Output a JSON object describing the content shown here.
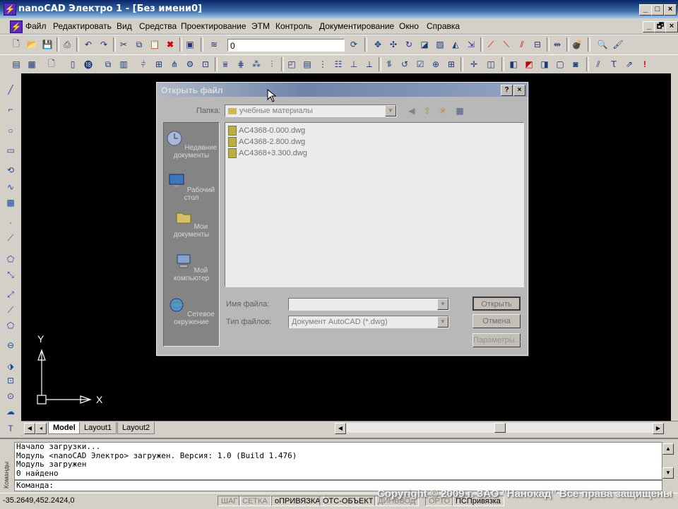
{
  "window": {
    "title": "nanoCAD Электро 1 - [Без имени0]",
    "controls": [
      "_",
      "□",
      "×"
    ]
  },
  "menubar": {
    "items": [
      "Файл",
      "Редактировать",
      "Вид",
      "Средства",
      "Проектирование",
      "ЭТМ",
      "Контроль",
      "Документирование",
      "Окно",
      "Справка"
    ],
    "doc_controls": [
      "_",
      "🗗",
      "×"
    ]
  },
  "toolbar": {
    "layer_value": "0"
  },
  "ucs": {
    "x_label": "X",
    "y_label": "Y"
  },
  "layout_tabs": [
    "Model",
    "Layout1",
    "Layout2"
  ],
  "command": {
    "side_label": "Команды",
    "log": [
      "Начало загрузки...",
      "Модуль <nanoCAD Электро> загружен. Версия: 1.0 (Build 1.476)",
      "Модуль загружен",
      "0 найдено"
    ],
    "prompt": "Команда:"
  },
  "status": {
    "coords": "-35.2649,452.2424,0",
    "toggles": [
      {
        "label": "ШАГ",
        "on": false
      },
      {
        "label": "СЕТКА",
        "on": false
      },
      {
        "label": "оПРИВЯЗКА",
        "on": true
      },
      {
        "label": "ОТС-ОБЪЕКТ",
        "on": true
      },
      {
        "label": "ДИНВВОД",
        "on": false
      },
      {
        "label": "ОРТО",
        "on": false
      },
      {
        "label": "ПСПривязка",
        "on": true
      }
    ],
    "copyright": "Copyright © 2009 г. ЗАО \"Нанокад\" Все права защищены"
  },
  "dialog": {
    "title": "Открыть файл",
    "folder_label": "Папка:",
    "folder_value": "учебные материалы",
    "places": [
      {
        "label": "Недавние документы",
        "icon": "recent-docs-icon"
      },
      {
        "label": "Рабочий стол",
        "icon": "desktop-icon"
      },
      {
        "label": "Мои документы",
        "icon": "my-docs-icon"
      },
      {
        "label": "Мой компьютер",
        "icon": "my-computer-icon"
      },
      {
        "label": "Сетевое окружение",
        "icon": "network-icon"
      }
    ],
    "files": [
      "AC4368-0.000.dwg",
      "AC4368-2.800.dwg",
      "AC4368+3.300.dwg"
    ],
    "filename_label": "Имя файла:",
    "filename_value": "",
    "filetype_label": "Тип файлов:",
    "filetype_value": "Документ AutoCAD (*.dwg)",
    "open_button": "Открыть",
    "cancel_button": "Отмена",
    "params_button": "Параметры..."
  }
}
